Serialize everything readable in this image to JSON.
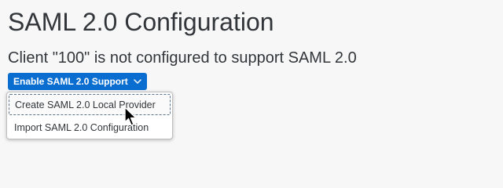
{
  "page": {
    "title": "SAML 2.0 Configuration",
    "message": "Client \"100\" is not configured to support SAML 2.0"
  },
  "menu_button": {
    "label": "Enable SAML 2.0 Support",
    "icon": "chevron-down-icon",
    "color": "#0a6ed1"
  },
  "dropdown": {
    "items": [
      {
        "label": "Create SAML 2.0 Local Provider"
      },
      {
        "label": "Import SAML 2.0 Configuration"
      }
    ]
  },
  "cursor": {
    "icon": "mouse-pointer-icon"
  }
}
